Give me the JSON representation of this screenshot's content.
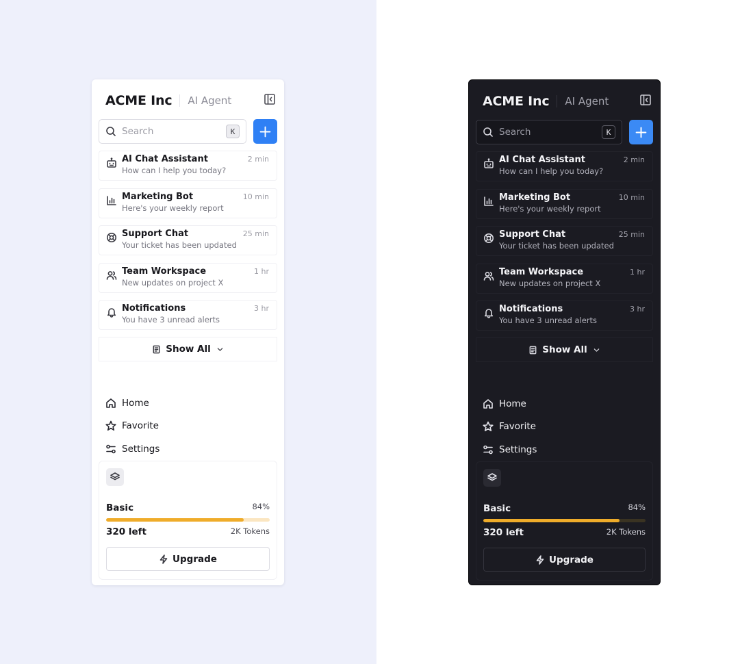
{
  "sidebar": {
    "brand": "ACME Inc",
    "subtitle": "AI Agent",
    "collapse_icon": "sidebar-collapse-icon",
    "search": {
      "placeholder": "Search",
      "shortcut": "K",
      "icon": "search-icon"
    },
    "new_button_icon": "plus-icon",
    "chats": [
      {
        "title": "AI Chat Assistant",
        "preview": "How can I help you today?",
        "time": "2 min",
        "icon": "bot-icon"
      },
      {
        "title": "Marketing Bot",
        "preview": "Here's your weekly report",
        "time": "10 min",
        "icon": "bar-chart-icon"
      },
      {
        "title": "Support Chat",
        "preview": "Your ticket has been updated",
        "time": "25 min",
        "icon": "life-buoy-icon"
      },
      {
        "title": "Team Workspace",
        "preview": "New updates on project X",
        "time": "1 hr",
        "icon": "users-icon"
      },
      {
        "title": "Notifications",
        "preview": "You have 3 unread alerts",
        "time": "3 hr",
        "icon": "bell-icon"
      }
    ],
    "show_all": {
      "label": "Show All",
      "icon": "document-icon",
      "chevron": "chevron-down-icon"
    },
    "nav": [
      {
        "label": "Home",
        "icon": "home-icon"
      },
      {
        "label": "Favorite",
        "icon": "star-icon"
      },
      {
        "label": "Settings",
        "icon": "sliders-icon"
      }
    ],
    "plan": {
      "icon": "layers-icon",
      "name": "Basic",
      "percent_label": "84%",
      "usage_fraction": 0.84,
      "remaining": "320 left",
      "total": "2K Tokens",
      "upgrade_label": "Upgrade",
      "upgrade_icon": "zap-icon"
    }
  },
  "themes": {
    "light": {
      "background": "#eef0fb",
      "panel": "#ffffff",
      "accent": "#2f80f5",
      "progress": "#efac2a"
    },
    "dark": {
      "background": "#ffffff",
      "panel": "#1b1b22",
      "accent": "#3b8af5",
      "progress": "#efac2a"
    }
  }
}
